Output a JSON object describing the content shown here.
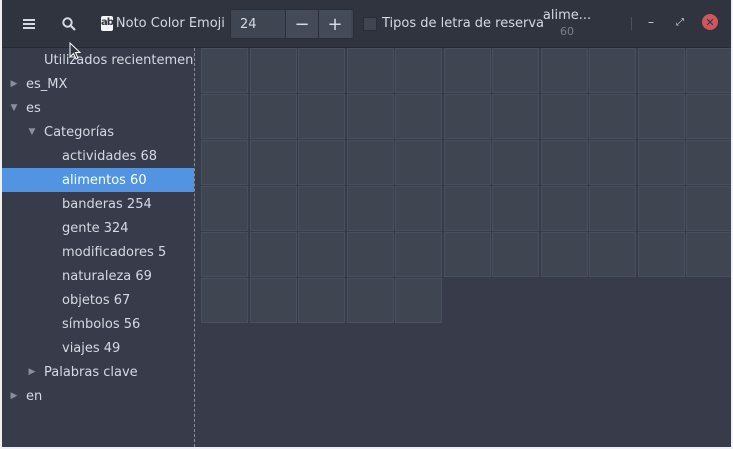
{
  "header": {
    "font_name": "Noto Color Emoji",
    "font_icon_text": "ab",
    "size_value": "24",
    "size_minus": "−",
    "size_plus": "+",
    "fallback_label": "Tipos de letra de reserva",
    "title": "alime...",
    "subtitle": "60",
    "minimize": "–",
    "maximize": "⤢",
    "close": "✕"
  },
  "sidebar": {
    "items": [
      {
        "label": "Utilizados recientemente",
        "indent": 1,
        "arrow": "",
        "selected": false
      },
      {
        "label": "es_MX",
        "indent": 0,
        "arrow": "right",
        "selected": false
      },
      {
        "label": "es",
        "indent": 0,
        "arrow": "down",
        "selected": false
      },
      {
        "label": "Categorías",
        "indent": 1,
        "arrow": "down",
        "selected": false
      },
      {
        "label": "actividades 68",
        "indent": 2,
        "arrow": "",
        "selected": false
      },
      {
        "label": "alimentos 60",
        "indent": 2,
        "arrow": "",
        "selected": true
      },
      {
        "label": "banderas 254",
        "indent": 2,
        "arrow": "",
        "selected": false
      },
      {
        "label": "gente 324",
        "indent": 2,
        "arrow": "",
        "selected": false
      },
      {
        "label": "modificadores 5",
        "indent": 2,
        "arrow": "",
        "selected": false
      },
      {
        "label": "naturaleza 69",
        "indent": 2,
        "arrow": "",
        "selected": false
      },
      {
        "label": "objetos 67",
        "indent": 2,
        "arrow": "",
        "selected": false
      },
      {
        "label": "símbolos 56",
        "indent": 2,
        "arrow": "",
        "selected": false
      },
      {
        "label": "viajes 49",
        "indent": 2,
        "arrow": "",
        "selected": false
      },
      {
        "label": "Palabras clave",
        "indent": 1,
        "arrow": "right",
        "selected": false
      },
      {
        "label": "en",
        "indent": 0,
        "arrow": "right",
        "selected": false
      }
    ]
  },
  "grid": {
    "total_cells": 60
  },
  "colors": {
    "accent": "#5294e2",
    "close": "#cc575d",
    "background": "#383c4a",
    "header": "#2f343f"
  }
}
